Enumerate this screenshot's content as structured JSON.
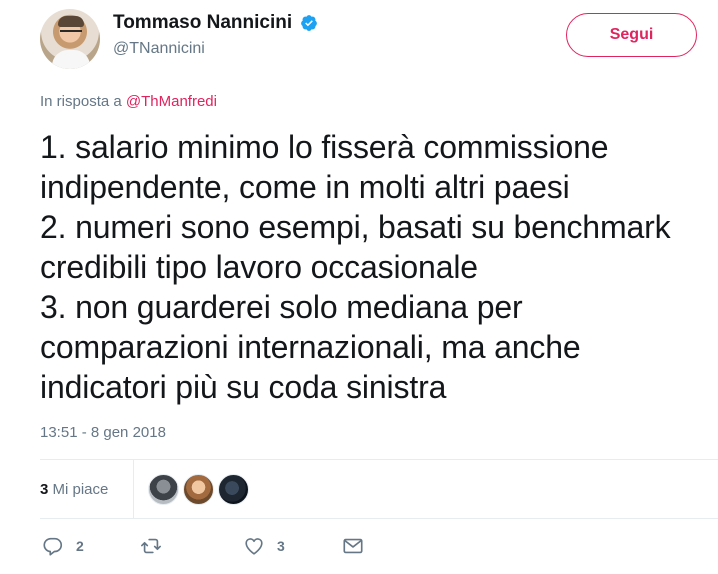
{
  "author": {
    "display_name": "Tommaso Nannicini",
    "handle": "@TNannicini",
    "verified": true
  },
  "follow_button": {
    "label": "Segui"
  },
  "reply_context": {
    "prefix": "In risposta a",
    "mention": "@ThManfredi"
  },
  "tweet": {
    "text": "1. salario minimo lo fisserà commissione\nindipendente, come in molti altri paesi\n2. numeri sono esempi, basati su benchmark\ncredibili tipo lavoro occasionale\n3. non guarderei solo mediana per\ncomparazioni internazionali, ma anche\nindicatori più su coda sinistra",
    "timestamp": "13:51 - 8 gen 2018"
  },
  "stats": {
    "likes_count": "3",
    "likes_label": "Mi piace"
  },
  "actions": {
    "reply_count": "2",
    "retweet_count": "",
    "like_count": "3"
  },
  "icons": {
    "verified": "verified-badge-icon",
    "reply": "reply-icon",
    "retweet": "retweet-icon",
    "like": "heart-icon",
    "dm": "envelope-icon"
  },
  "colors": {
    "accent": "#e0245e",
    "verified": "#1da1f2",
    "secondary_text": "#657786"
  }
}
